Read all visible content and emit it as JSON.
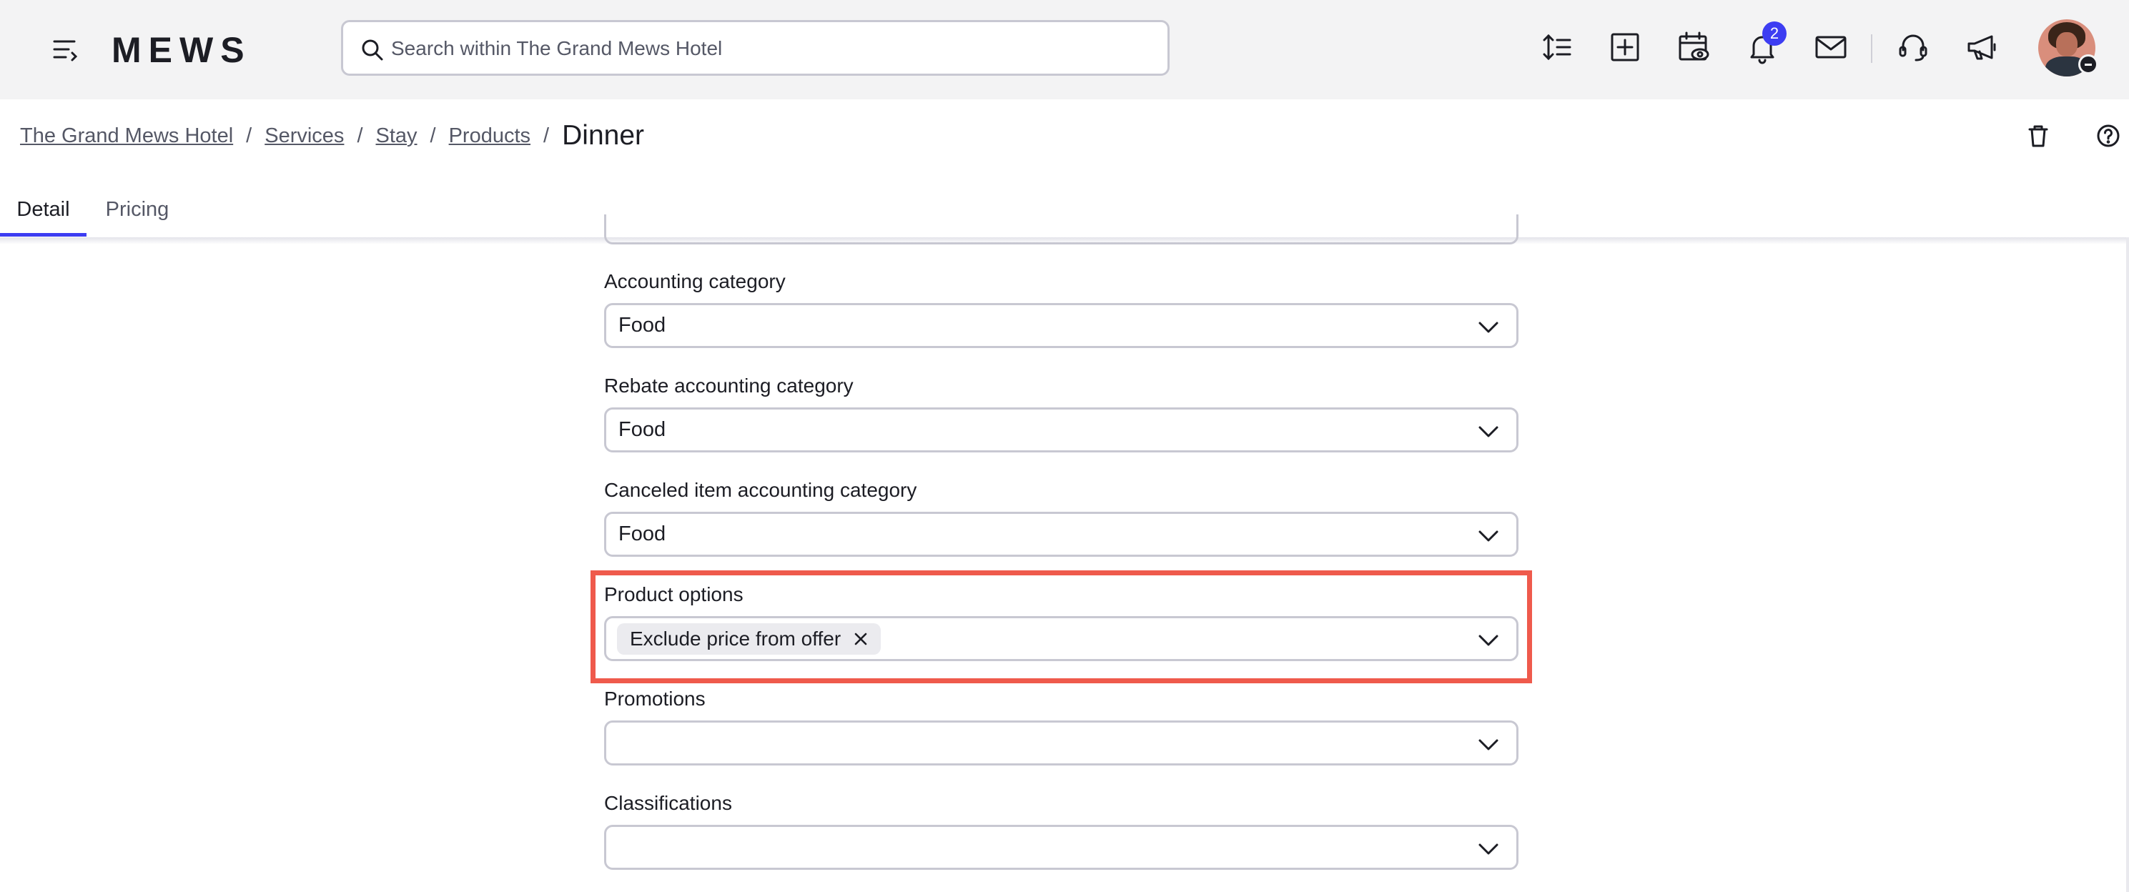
{
  "topbar": {
    "logo_text": "MEWS",
    "search_placeholder": "Search within The Grand Mews Hotel",
    "notifications_count": "2",
    "icons": [
      "menu-icon",
      "line-height-icon",
      "add-square-icon",
      "calendar-eye-icon",
      "bell-icon",
      "mail-icon",
      "headset-icon",
      "megaphone-icon"
    ]
  },
  "breadcrumb": {
    "items": [
      "The Grand Mews Hotel",
      "Services",
      "Stay",
      "Products"
    ],
    "separator": "/",
    "current": "Dinner"
  },
  "header_actions": [
    "trash-icon",
    "help-icon"
  ],
  "tabs": [
    {
      "label": "Detail",
      "active": true
    },
    {
      "label": "Pricing",
      "active": false
    }
  ],
  "form": {
    "accounting_category": {
      "label": "Accounting category",
      "value": "Food"
    },
    "rebate_accounting_category": {
      "label": "Rebate accounting category",
      "value": "Food"
    },
    "canceled_item_accounting_category": {
      "label": "Canceled item accounting category",
      "value": "Food"
    },
    "product_options": {
      "label": "Product options",
      "chips": [
        "Exclude price from offer"
      ]
    },
    "promotions": {
      "label": "Promotions",
      "value": ""
    },
    "classifications": {
      "label": "Classifications",
      "value": ""
    }
  },
  "colors": {
    "accent": "#3d3df2",
    "highlight": "#ef5a4c",
    "topbar_bg": "#f3f3f4",
    "border": "#c8c8d2"
  }
}
